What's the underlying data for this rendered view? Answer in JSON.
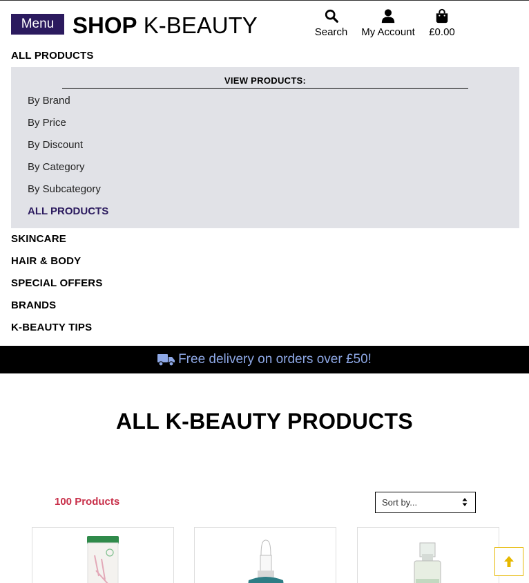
{
  "header": {
    "menu_label": "Menu",
    "logo_bold": "SHOP",
    "logo_regular": "K-BEAUTY",
    "search_label": "Search",
    "account_label": "My Account",
    "cart_total": "£0.00"
  },
  "nav": {
    "top_item": "ALL PRODUCTS",
    "dropdown_heading": "VIEW PRODUCTS:",
    "dropdown_items": [
      "By Brand",
      "By Price",
      "By Discount",
      "By Category",
      "By Subcategory",
      "ALL PRODUCTS"
    ],
    "items": [
      "SKINCARE",
      "HAIR & BODY",
      "SPECIAL OFFERS",
      "BRANDS",
      "K-BEAUTY TIPS"
    ]
  },
  "banner": {
    "text": "Free delivery on orders over £50!"
  },
  "main": {
    "title": "ALL K-BEAUTY PRODUCTS",
    "product_count": "100 Products",
    "sort_placeholder": "Sort by..."
  },
  "colors": {
    "brand": "#2b1a5e",
    "banner_text": "#8ea8e6",
    "count": "#c8304a",
    "back_to_top_border": "#e6b800"
  },
  "icons": [
    "search-icon",
    "user-icon",
    "shopping-bag-icon",
    "truck-icon",
    "sort-arrows-icon",
    "arrow-up-icon"
  ]
}
